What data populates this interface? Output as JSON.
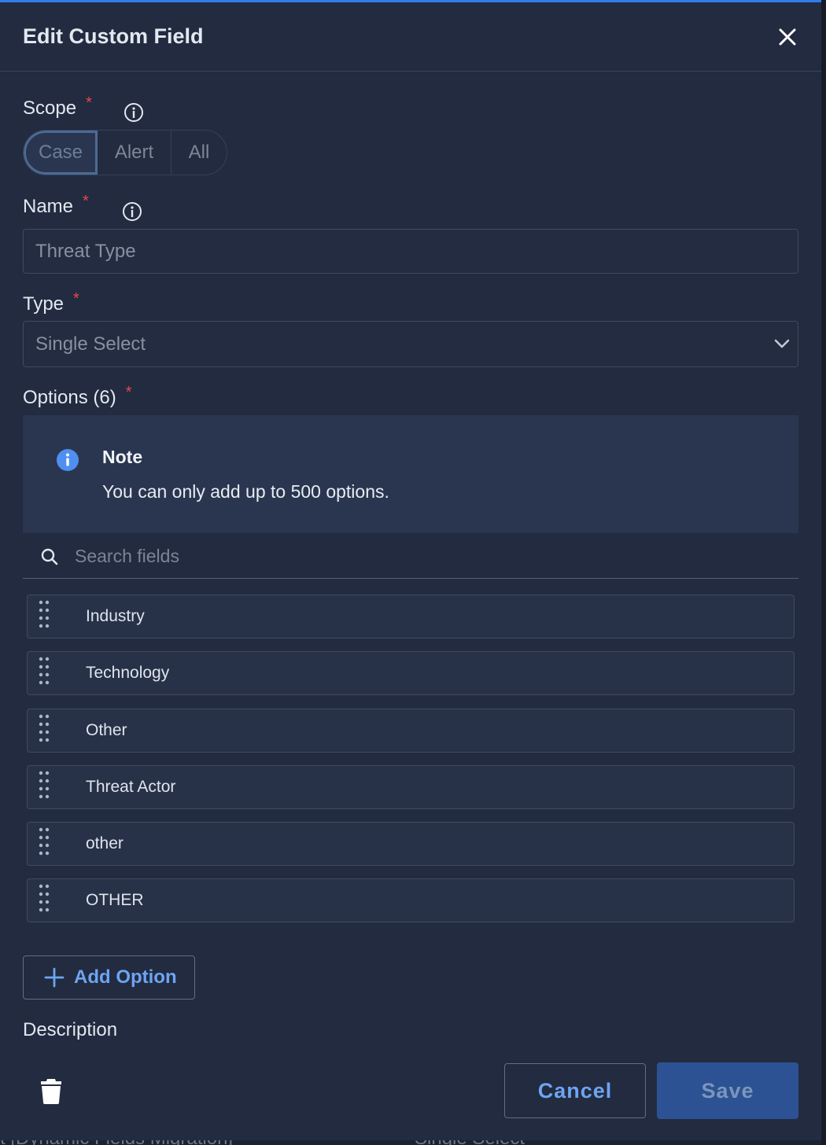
{
  "modal": {
    "title": "Edit Custom Field"
  },
  "scope": {
    "label": "Scope",
    "required_mark": "*",
    "options": [
      "Case",
      "Alert",
      "All"
    ],
    "selected": "Case"
  },
  "name": {
    "label": "Name",
    "required_mark": "*",
    "value": "Threat Type"
  },
  "type": {
    "label": "Type",
    "required_mark": "*",
    "value": "Single Select"
  },
  "options": {
    "label": "Options (6)",
    "required_mark": "*",
    "note_title": "Note",
    "note_text": "You can only add up to 500 options.",
    "search_placeholder": "Search fields",
    "items": [
      "Industry",
      "Technology",
      "Other",
      "Threat Actor",
      "other",
      "OTHER"
    ],
    "add_label": "Add Option"
  },
  "description": {
    "label": "Description"
  },
  "footer": {
    "cancel_label": "Cancel",
    "save_label": "Save"
  },
  "background": {
    "left_text": "t [Dynamic Fields Migration]",
    "right_text": "Single Select"
  },
  "colors": {
    "accent": "#2f7ee8",
    "required": "#e5484d",
    "link": "#6ea4f2",
    "save_bg": "#2c5293"
  }
}
